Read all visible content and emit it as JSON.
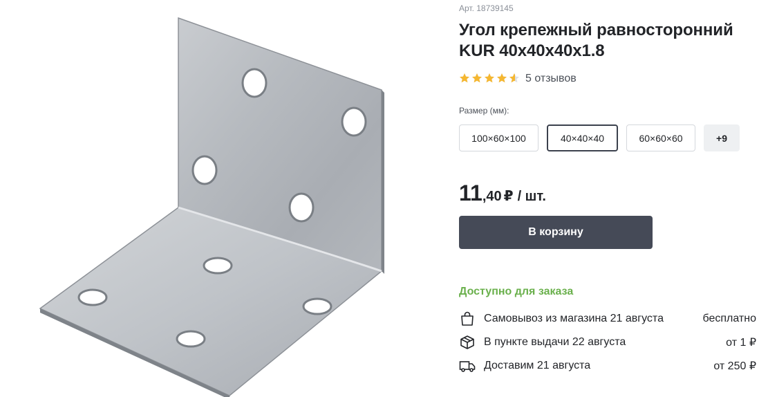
{
  "product": {
    "sku": "Арт. 18739145",
    "title": "Угол крепежный равносторонний KUR 40x40x40x1.8",
    "rating": 4.5,
    "reviews": "5 отзывов",
    "image": "galvanized-angle-bracket"
  },
  "size": {
    "label": "Размер (мм):",
    "options": [
      "100×60×100",
      "40×40×40",
      "60×60×60",
      "+9"
    ],
    "selected": "40×40×40"
  },
  "price": {
    "integer": "11",
    "decimal": ",40",
    "currency": "₽",
    "unit": "/ шт."
  },
  "cart_button": "В корзину",
  "availability": "Доступно для заказа",
  "delivery": [
    {
      "icon": "bag-icon",
      "text": "Самовывоз из магазина 21 августа",
      "cost": "бесплатно"
    },
    {
      "icon": "box-icon",
      "text": "В пункте выдачи 22 августа",
      "cost": "от 1 ₽"
    },
    {
      "icon": "truck-icon",
      "text": "Доставим 21 августа",
      "cost": "от 250 ₽"
    }
  ],
  "colors": {
    "primary_button": "#454a57",
    "available_green": "#6ab04c",
    "star": "#f5b731",
    "star_empty": "#dcdfe4"
  }
}
